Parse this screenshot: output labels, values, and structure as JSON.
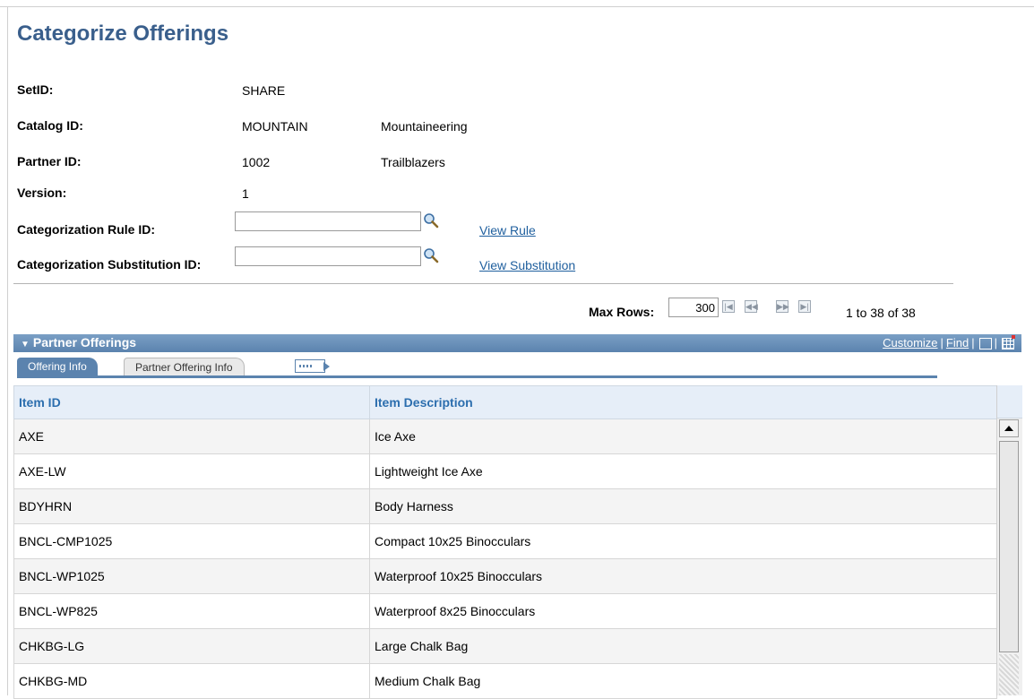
{
  "page": {
    "title": "Categorize Offerings"
  },
  "fields": {
    "setid": {
      "label": "SetID:",
      "value": "SHARE"
    },
    "catalog": {
      "label": "Catalog ID:",
      "value": "MOUNTAIN",
      "description": "Mountaineering"
    },
    "partner": {
      "label": "Partner ID:",
      "value": "1002",
      "description": "Trailblazers"
    },
    "version": {
      "label": "Version:",
      "value": "1"
    },
    "rule": {
      "label": "Categorization Rule ID:",
      "value": "",
      "link": "View Rule"
    },
    "substitution": {
      "label": "Categorization Substitution ID:",
      "value": "",
      "link": "View Substitution"
    }
  },
  "paging": {
    "max_rows_label": "Max Rows:",
    "max_rows_value": "300",
    "count_text": "1 to 38 of 38"
  },
  "grid": {
    "title": "Partner Offerings",
    "customize_label": "Customize",
    "find_label": "Find",
    "tabs": [
      {
        "label": "Offering Info",
        "active": true
      },
      {
        "label": "Partner Offering Info",
        "active": false
      }
    ],
    "columns": [
      "Item ID",
      "Item Description"
    ],
    "rows": [
      [
        "AXE",
        "Ice Axe"
      ],
      [
        "AXE-LW",
        "Lightweight Ice Axe"
      ],
      [
        "BDYHRN",
        "Body Harness"
      ],
      [
        "BNCL-CMP1025",
        "Compact 10x25 Binocculars"
      ],
      [
        "BNCL-WP1025",
        "Waterproof 10x25 Binocculars"
      ],
      [
        "BNCL-WP825",
        "Waterproof 8x25 Binocculars"
      ],
      [
        "CHKBG-LG",
        "Large Chalk Bag"
      ],
      [
        "CHKBG-MD",
        "Medium Chalk Bag"
      ]
    ]
  },
  "colors": {
    "title": "#3a5f8c",
    "header_bar": "#5b83ae",
    "link": "#1f5f9e",
    "column_header_text": "#2c6eae"
  },
  "icons": [
    "lookup-icon",
    "first-page-icon",
    "previous-page-icon",
    "next-page-icon",
    "last-page-icon",
    "collapse-triangle-icon",
    "zoom-icon",
    "download-icon",
    "show-all-columns-icon"
  ]
}
